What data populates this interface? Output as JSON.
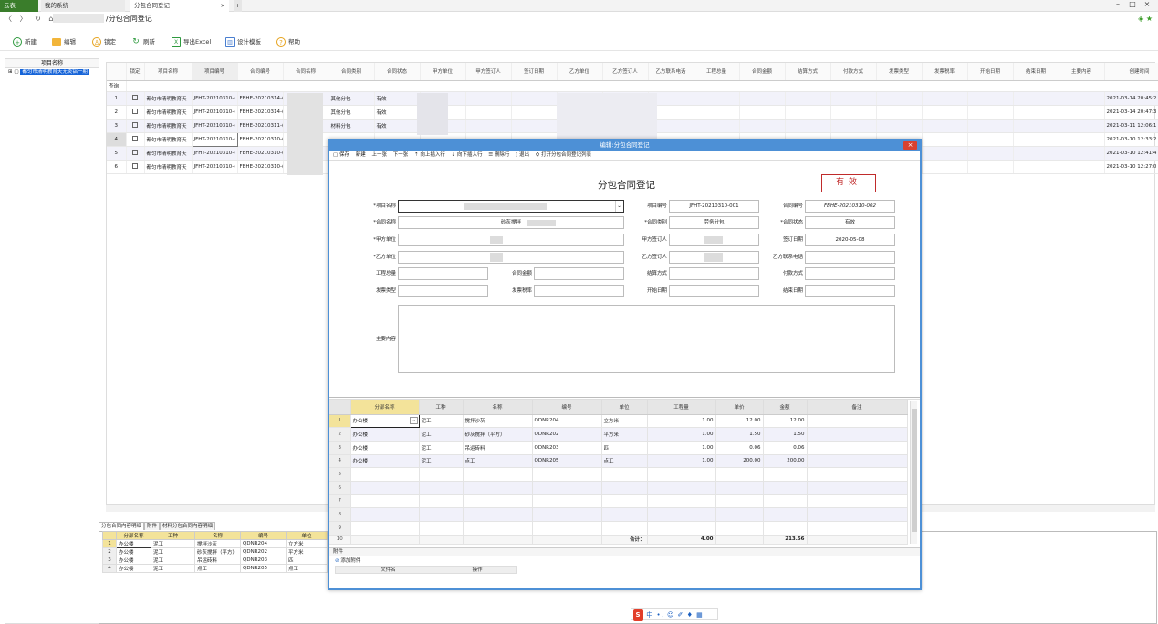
{
  "tabs": {
    "app": "云表",
    "system": "我的系统",
    "current": "分包合同登记",
    "close": "×"
  },
  "window": {
    "minimize": "–",
    "maximize": "□",
    "close": "×"
  },
  "address": {
    "nav": "〈 〉 ↻ ⌂",
    "path": "/分包合同登记",
    "star": "◈ ★"
  },
  "toolbar": {
    "new": "新建",
    "edit": "编辑",
    "lock": "锁定",
    "refresh": "刷新",
    "export": "导出Excel",
    "design": "设计模板",
    "help": "帮助"
  },
  "left": {
    "header": "项目名称",
    "item": "都匀市清明教育天无炎铝一期"
  },
  "grid": {
    "headers": [
      "锁定",
      "项目名称",
      "项目编号",
      "合同编号",
      "合同名称",
      "合同类别",
      "合同状态",
      "甲方单位",
      "甲方签订人",
      "签订日期",
      "乙方单位",
      "乙方签订人",
      "乙方联系电话",
      "工程总量",
      "合同金额",
      "结算方式",
      "付款方式",
      "发票类型",
      "发票税率",
      "开始日期",
      "结束日期",
      "主要内容",
      "创建时间"
    ],
    "query": "查询",
    "rows": [
      {
        "n": "1",
        "proj": "都匀市清明教育天",
        "pno": "JFHT-20210310-(",
        "cno": "FBHE-20210314-(",
        "ctype": "其他分包",
        "status": "有效",
        "created": "2021-03-14 20:45:2"
      },
      {
        "n": "2",
        "proj": "都匀市清明教育天",
        "pno": "JFHT-20210310-(",
        "cno": "FBHE-20210314-(",
        "ctype": "其他分包",
        "status": "有效",
        "created": "2021-03-14 20:47:3"
      },
      {
        "n": "3",
        "proj": "都匀市清明教育天",
        "pno": "JFHT-20210310-(",
        "cno": "FBHE-20210311-(",
        "ctype": "材料分包",
        "status": "有效",
        "created": "2021-03-11 12:06:1"
      },
      {
        "n": "4",
        "proj": "都匀市清明教育天",
        "pno": "JFHT-20210310-(",
        "cno": "FBHE-20210310-(",
        "ctype": "",
        "status": "",
        "created": "2021-03-10 12:33:2"
      },
      {
        "n": "5",
        "proj": "都匀市清明教育天",
        "pno": "JFHT-20210310-(",
        "cno": "FBHE-20210310-(",
        "ctype": "",
        "status": "",
        "created": "2021-03-10 12:41:4"
      },
      {
        "n": "6",
        "proj": "都匀市清明教育天",
        "pno": "JFHT-20210310-(",
        "cno": "FBHE-20210310-(",
        "ctype": "",
        "status": "",
        "created": "2021-03-10 12:27:0"
      }
    ]
  },
  "bottom": {
    "tabs": [
      "分包合同内容明细",
      "附件",
      "材料分包合同内容明细"
    ],
    "headers": [
      "分部名称",
      "工种",
      "名称",
      "编号",
      "单位"
    ],
    "rows": [
      [
        "1",
        "办公楼",
        "泥工",
        "搅拌沙灰",
        "QDNR204",
        "立方米"
      ],
      [
        "2",
        "办公楼",
        "泥工",
        "砂灰搅拌（平方）",
        "QDNR202",
        "平方米"
      ],
      [
        "3",
        "办公楼",
        "泥工",
        "吊运砖料",
        "QDNR203",
        "匹"
      ],
      [
        "4",
        "办公楼",
        "泥工",
        "点工",
        "QDNR205",
        "点工"
      ]
    ]
  },
  "modal": {
    "title": "编辑:分包合同登记",
    "close": "×",
    "tools": [
      "▢ 保存",
      "新建",
      "上一张",
      "下一张",
      "⇡ 向上插入行",
      "⇣ 向下插入行",
      "☰ 删除行",
      "[ 退出",
      "⛭ 打开分包合同登记列表"
    ],
    "form_title": "分包合同登记",
    "seal": "有效",
    "labels": {
      "project": "*项目名称",
      "pno": "项目编号",
      "cno": "合同编号",
      "cname": "*合同名称",
      "ctype": "*合同类别",
      "status": "*合同状态",
      "party_a": "*甲方单位",
      "signer_a": "甲方签订人",
      "sign_date": "签订日期",
      "party_b": "*乙方单位",
      "signer_b": "乙方签订人",
      "phone_b": "乙方联系电话",
      "qty": "工程总量",
      "amount": "合同金额",
      "settle": "结算方式",
      "pay": "付款方式",
      "invoice_type": "发票类型",
      "tax": "发票税率",
      "start": "开始日期",
      "end": "结束日期",
      "content": "主要内容"
    },
    "values": {
      "pno": "JFHT-20210310-001",
      "cno": "FBHE-20210310-002",
      "cname": "砂灰搅拌",
      "ctype": "劳务分包",
      "status": "有效",
      "sign_date": "2020-05-08",
      "dropdown": "⌄"
    },
    "table": {
      "headers": [
        "分部名称",
        "工种",
        "名称",
        "编号",
        "单位",
        "工程量",
        "单价",
        "金额",
        "备注"
      ],
      "rows": [
        [
          "1",
          "办公楼",
          "泥工",
          "搅拌沙灰",
          "QDNR204",
          "立方米",
          "1.00",
          "12.00",
          "12.00",
          ""
        ],
        [
          "2",
          "办公楼",
          "泥工",
          "砂灰搅拌（平方）",
          "QDNR202",
          "平方米",
          "1.00",
          "1.50",
          "1.50",
          ""
        ],
        [
          "3",
          "办公楼",
          "泥工",
          "吊运砖料",
          "QDNR203",
          "匹",
          "1.00",
          "0.06",
          "0.06",
          ""
        ],
        [
          "4",
          "办公楼",
          "泥工",
          "点工",
          "QDNR205",
          "点工",
          "1.00",
          "200.00",
          "200.00",
          ""
        ],
        [
          "5",
          "",
          "",
          "",
          "",
          "",
          "",
          "",
          "",
          ""
        ],
        [
          "6",
          "",
          "",
          "",
          "",
          "",
          "",
          "",
          "",
          ""
        ],
        [
          "7",
          "",
          "",
          "",
          "",
          "",
          "",
          "",
          "",
          ""
        ],
        [
          "8",
          "",
          "",
          "",
          "",
          "",
          "",
          "",
          "",
          ""
        ],
        [
          "9",
          "",
          "",
          "",
          "",
          "",
          "",
          "",
          "",
          ""
        ]
      ],
      "total_row": {
        "n": "10",
        "label": "合计：",
        "qty": "4.00",
        "amount": "213.56"
      },
      "ellipsis": "···"
    },
    "attach": {
      "title": "附件",
      "add": "添加附件",
      "cols": [
        "文件名",
        "操作"
      ]
    }
  },
  "ime": "中 •, ☺ ✐ ♦ ▦",
  "ime_logo": "S"
}
